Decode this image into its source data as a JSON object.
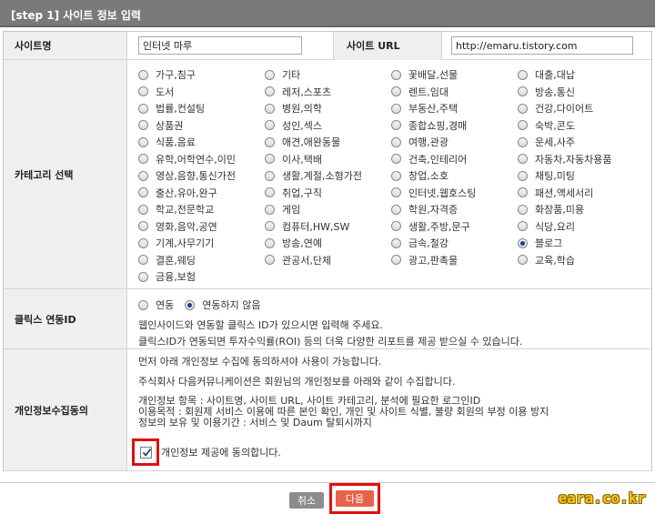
{
  "header": {
    "title": "[step 1] 사이트 정보 입력"
  },
  "site": {
    "name_label": "사이트명",
    "name_value": "인터넷 마루",
    "url_label": "사이트 URL",
    "url_value": "http://emaru.tistory.com"
  },
  "category": {
    "label": "카테고리 선택",
    "selected": "블로그",
    "items": [
      {
        "label": "가구,침구",
        "checked": false
      },
      {
        "label": "기타",
        "checked": false
      },
      {
        "label": "꽃배달,선물",
        "checked": false
      },
      {
        "label": "대출,대납",
        "checked": false
      },
      {
        "label": "도서",
        "checked": false
      },
      {
        "label": "레저,스포츠",
        "checked": false
      },
      {
        "label": "렌트,임대",
        "checked": false
      },
      {
        "label": "방송,통신",
        "checked": false
      },
      {
        "label": "법률,컨설팅",
        "checked": false
      },
      {
        "label": "병원,의학",
        "checked": false
      },
      {
        "label": "부동산,주택",
        "checked": false
      },
      {
        "label": "건강,다이어트",
        "checked": false
      },
      {
        "label": "상품권",
        "checked": false
      },
      {
        "label": "성인,섹스",
        "checked": false
      },
      {
        "label": "종합쇼핑,경매",
        "checked": false
      },
      {
        "label": "숙박,콘도",
        "checked": false
      },
      {
        "label": "식품,음료",
        "checked": false
      },
      {
        "label": "애견,애완동물",
        "checked": false
      },
      {
        "label": "여행,관광",
        "checked": false
      },
      {
        "label": "운세,사주",
        "checked": false
      },
      {
        "label": "유학,어학연수,이민",
        "checked": false
      },
      {
        "label": "이사,택배",
        "checked": false
      },
      {
        "label": "건축,인테리어",
        "checked": false
      },
      {
        "label": "자동차,자동차용품",
        "checked": false
      },
      {
        "label": "영상,음향,통신가전",
        "checked": false
      },
      {
        "label": "생활,계절,소형가전",
        "checked": false
      },
      {
        "label": "창업,소호",
        "checked": false
      },
      {
        "label": "채팅,미팅",
        "checked": false
      },
      {
        "label": "출산,유아,완구",
        "checked": false
      },
      {
        "label": "취업,구직",
        "checked": false
      },
      {
        "label": "인터넷,웹호스팅",
        "checked": false
      },
      {
        "label": "패션,액세서리",
        "checked": false
      },
      {
        "label": "학교,전문학교",
        "checked": false
      },
      {
        "label": "게임",
        "checked": false
      },
      {
        "label": "학원,자격증",
        "checked": false
      },
      {
        "label": "화장품,미용",
        "checked": false
      },
      {
        "label": "영화,음악,공연",
        "checked": false
      },
      {
        "label": "컴퓨터,HW,SW",
        "checked": false
      },
      {
        "label": "생활,주방,문구",
        "checked": false
      },
      {
        "label": "식당,요리",
        "checked": false
      },
      {
        "label": "기계,사무기기",
        "checked": false
      },
      {
        "label": "방송,연예",
        "checked": false
      },
      {
        "label": "금속,철강",
        "checked": false
      },
      {
        "label": "블로그",
        "checked": true
      },
      {
        "label": "결혼,웨딩",
        "checked": false
      },
      {
        "label": "관공서,단체",
        "checked": false
      },
      {
        "label": "광고,판촉물",
        "checked": false
      },
      {
        "label": "교육,학습",
        "checked": false
      },
      {
        "label": "금융,보험",
        "checked": false
      }
    ]
  },
  "click": {
    "label": "클릭스 연동ID",
    "option_link": "연동",
    "option_nolink": "연동하지 않음",
    "selected": "연동하지 않음",
    "note1": "웹인사이드와 연동할 클릭스 ID가 있으시면 입력해 주세요.",
    "note2": "클릭스ID가 연동되면 투자수익률(ROI) 등의 더욱 다양한 리포트를 제공 받으실 수 있습니다."
  },
  "privacy": {
    "label": "개인정보수집동의",
    "line1": "먼저 아래 개인정보 수집에 동의하셔야 사용이 가능합니다.",
    "line2": "주식회사 다음커뮤니케이션은 회원님의 개인정보를 아래와 같이 수집합니다.",
    "line3": "개인정보 항목 : 사이트명, 사이트 URL, 사이트 카테고리, 분석에 필요한 로그인ID",
    "line4": "이용목적 : 회원제 서비스 이용에 따른 본인 확인, 개인 및 사이트 식별, 불량 회원의 부정 이용 방지",
    "line5": "정보의 보유 및 이용기간 : 서비스 및 Daum 탈퇴시까지",
    "agree_text": "개인정보 제공에 동의합니다.",
    "agree_checked": true
  },
  "buttons": {
    "cancel": "취소",
    "next": "다음"
  },
  "watermark": "eara.co.kr",
  "colors": {
    "header": "#7a7a7a",
    "next_button": "#e8624a",
    "highlight": "#e01010",
    "watermark": "#f4c21c"
  }
}
